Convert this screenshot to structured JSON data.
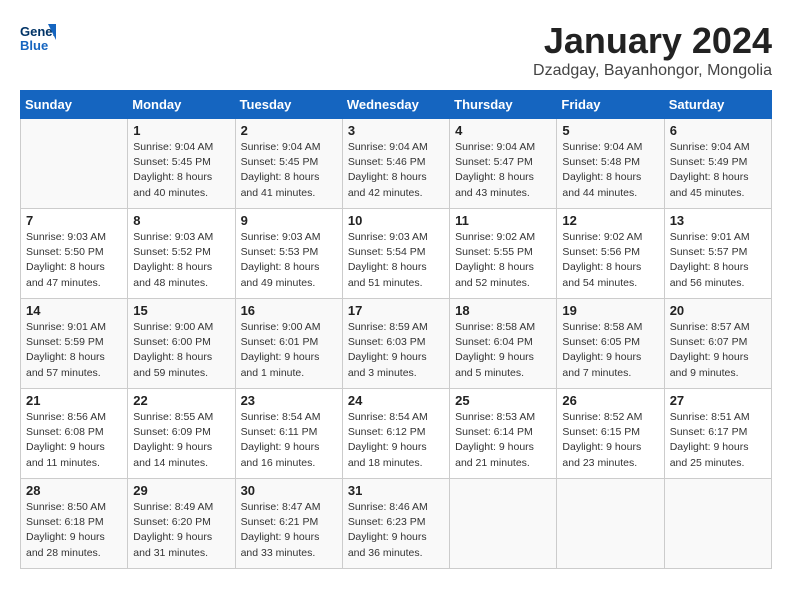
{
  "header": {
    "logo_general": "General",
    "logo_blue": "Blue",
    "month_title": "January 2024",
    "location": "Dzadgay, Bayanhongor, Mongolia"
  },
  "weekdays": [
    "Sunday",
    "Monday",
    "Tuesday",
    "Wednesday",
    "Thursday",
    "Friday",
    "Saturday"
  ],
  "rows": [
    [
      {
        "day": "",
        "lines": []
      },
      {
        "day": "1",
        "lines": [
          "Sunrise: 9:04 AM",
          "Sunset: 5:45 PM",
          "Daylight: 8 hours",
          "and 40 minutes."
        ]
      },
      {
        "day": "2",
        "lines": [
          "Sunrise: 9:04 AM",
          "Sunset: 5:45 PM",
          "Daylight: 8 hours",
          "and 41 minutes."
        ]
      },
      {
        "day": "3",
        "lines": [
          "Sunrise: 9:04 AM",
          "Sunset: 5:46 PM",
          "Daylight: 8 hours",
          "and 42 minutes."
        ]
      },
      {
        "day": "4",
        "lines": [
          "Sunrise: 9:04 AM",
          "Sunset: 5:47 PM",
          "Daylight: 8 hours",
          "and 43 minutes."
        ]
      },
      {
        "day": "5",
        "lines": [
          "Sunrise: 9:04 AM",
          "Sunset: 5:48 PM",
          "Daylight: 8 hours",
          "and 44 minutes."
        ]
      },
      {
        "day": "6",
        "lines": [
          "Sunrise: 9:04 AM",
          "Sunset: 5:49 PM",
          "Daylight: 8 hours",
          "and 45 minutes."
        ]
      }
    ],
    [
      {
        "day": "7",
        "lines": [
          "Sunrise: 9:03 AM",
          "Sunset: 5:50 PM",
          "Daylight: 8 hours",
          "and 47 minutes."
        ]
      },
      {
        "day": "8",
        "lines": [
          "Sunrise: 9:03 AM",
          "Sunset: 5:52 PM",
          "Daylight: 8 hours",
          "and 48 minutes."
        ]
      },
      {
        "day": "9",
        "lines": [
          "Sunrise: 9:03 AM",
          "Sunset: 5:53 PM",
          "Daylight: 8 hours",
          "and 49 minutes."
        ]
      },
      {
        "day": "10",
        "lines": [
          "Sunrise: 9:03 AM",
          "Sunset: 5:54 PM",
          "Daylight: 8 hours",
          "and 51 minutes."
        ]
      },
      {
        "day": "11",
        "lines": [
          "Sunrise: 9:02 AM",
          "Sunset: 5:55 PM",
          "Daylight: 8 hours",
          "and 52 minutes."
        ]
      },
      {
        "day": "12",
        "lines": [
          "Sunrise: 9:02 AM",
          "Sunset: 5:56 PM",
          "Daylight: 8 hours",
          "and 54 minutes."
        ]
      },
      {
        "day": "13",
        "lines": [
          "Sunrise: 9:01 AM",
          "Sunset: 5:57 PM",
          "Daylight: 8 hours",
          "and 56 minutes."
        ]
      }
    ],
    [
      {
        "day": "14",
        "lines": [
          "Sunrise: 9:01 AM",
          "Sunset: 5:59 PM",
          "Daylight: 8 hours",
          "and 57 minutes."
        ]
      },
      {
        "day": "15",
        "lines": [
          "Sunrise: 9:00 AM",
          "Sunset: 6:00 PM",
          "Daylight: 8 hours",
          "and 59 minutes."
        ]
      },
      {
        "day": "16",
        "lines": [
          "Sunrise: 9:00 AM",
          "Sunset: 6:01 PM",
          "Daylight: 9 hours",
          "and 1 minute."
        ]
      },
      {
        "day": "17",
        "lines": [
          "Sunrise: 8:59 AM",
          "Sunset: 6:03 PM",
          "Daylight: 9 hours",
          "and 3 minutes."
        ]
      },
      {
        "day": "18",
        "lines": [
          "Sunrise: 8:58 AM",
          "Sunset: 6:04 PM",
          "Daylight: 9 hours",
          "and 5 minutes."
        ]
      },
      {
        "day": "19",
        "lines": [
          "Sunrise: 8:58 AM",
          "Sunset: 6:05 PM",
          "Daylight: 9 hours",
          "and 7 minutes."
        ]
      },
      {
        "day": "20",
        "lines": [
          "Sunrise: 8:57 AM",
          "Sunset: 6:07 PM",
          "Daylight: 9 hours",
          "and 9 minutes."
        ]
      }
    ],
    [
      {
        "day": "21",
        "lines": [
          "Sunrise: 8:56 AM",
          "Sunset: 6:08 PM",
          "Daylight: 9 hours",
          "and 11 minutes."
        ]
      },
      {
        "day": "22",
        "lines": [
          "Sunrise: 8:55 AM",
          "Sunset: 6:09 PM",
          "Daylight: 9 hours",
          "and 14 minutes."
        ]
      },
      {
        "day": "23",
        "lines": [
          "Sunrise: 8:54 AM",
          "Sunset: 6:11 PM",
          "Daylight: 9 hours",
          "and 16 minutes."
        ]
      },
      {
        "day": "24",
        "lines": [
          "Sunrise: 8:54 AM",
          "Sunset: 6:12 PM",
          "Daylight: 9 hours",
          "and 18 minutes."
        ]
      },
      {
        "day": "25",
        "lines": [
          "Sunrise: 8:53 AM",
          "Sunset: 6:14 PM",
          "Daylight: 9 hours",
          "and 21 minutes."
        ]
      },
      {
        "day": "26",
        "lines": [
          "Sunrise: 8:52 AM",
          "Sunset: 6:15 PM",
          "Daylight: 9 hours",
          "and 23 minutes."
        ]
      },
      {
        "day": "27",
        "lines": [
          "Sunrise: 8:51 AM",
          "Sunset: 6:17 PM",
          "Daylight: 9 hours",
          "and 25 minutes."
        ]
      }
    ],
    [
      {
        "day": "28",
        "lines": [
          "Sunrise: 8:50 AM",
          "Sunset: 6:18 PM",
          "Daylight: 9 hours",
          "and 28 minutes."
        ]
      },
      {
        "day": "29",
        "lines": [
          "Sunrise: 8:49 AM",
          "Sunset: 6:20 PM",
          "Daylight: 9 hours",
          "and 31 minutes."
        ]
      },
      {
        "day": "30",
        "lines": [
          "Sunrise: 8:47 AM",
          "Sunset: 6:21 PM",
          "Daylight: 9 hours",
          "and 33 minutes."
        ]
      },
      {
        "day": "31",
        "lines": [
          "Sunrise: 8:46 AM",
          "Sunset: 6:23 PM",
          "Daylight: 9 hours",
          "and 36 minutes."
        ]
      },
      {
        "day": "",
        "lines": []
      },
      {
        "day": "",
        "lines": []
      },
      {
        "day": "",
        "lines": []
      }
    ]
  ]
}
